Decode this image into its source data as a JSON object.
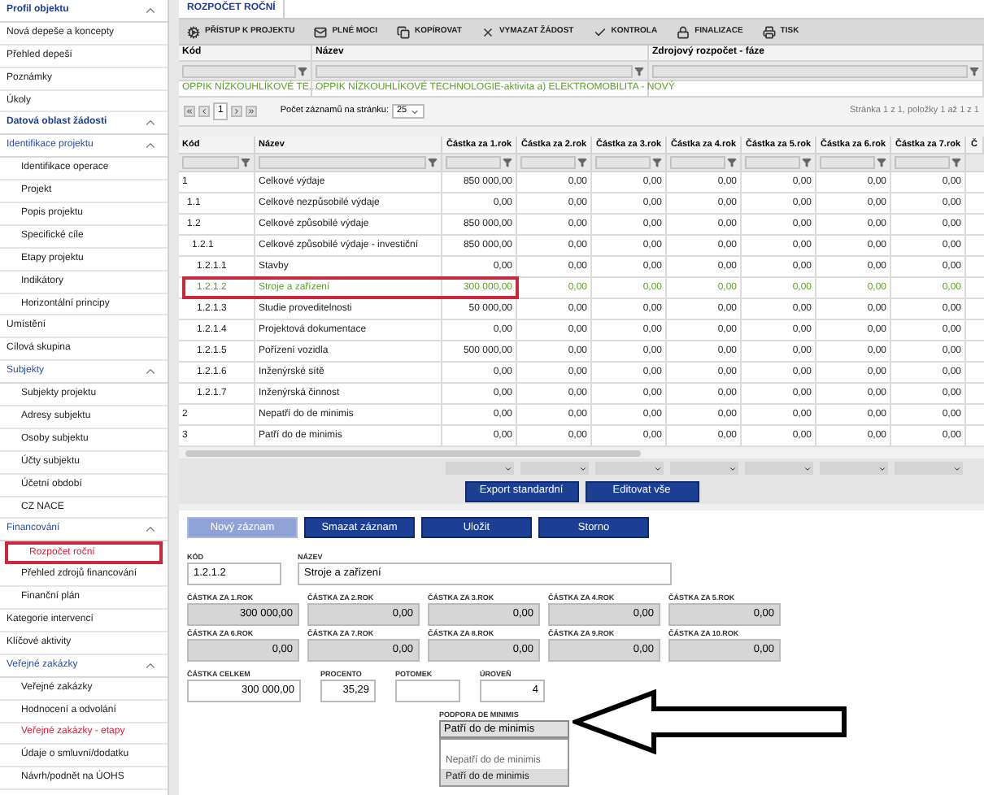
{
  "sidebar": {
    "groups": [
      {
        "title": "Profil objektu",
        "expanded": true,
        "items": [
          {
            "label": "Nová depeše a koncepty",
            "selected": false,
            "flagged": false
          },
          {
            "label": "Přehled depeší",
            "selected": false,
            "flagged": false
          },
          {
            "label": "Poznámky",
            "selected": false,
            "flagged": false
          },
          {
            "label": "Úkoly",
            "selected": false,
            "flagged": false
          }
        ]
      },
      {
        "title": "Datová oblast žádosti",
        "expanded": true,
        "items": [
          {
            "label": "Identifikace projektu",
            "expanded": true,
            "children": [
              {
                "label": "Identifikace operace",
                "selected": false,
                "flagged": false
              },
              {
                "label": "Projekt",
                "selected": false,
                "flagged": false
              },
              {
                "label": "Popis projektu",
                "selected": false,
                "flagged": false
              },
              {
                "label": "Specifické cíle",
                "selected": false,
                "flagged": false
              },
              {
                "label": "Etapy projektu",
                "selected": false,
                "flagged": false
              },
              {
                "label": "Indikátory",
                "selected": false,
                "flagged": false
              },
              {
                "label": "Horizontální principy",
                "selected": false,
                "flagged": false
              }
            ]
          },
          {
            "label": "Umístění",
            "selected": false,
            "flagged": false
          },
          {
            "label": "Cílová skupina",
            "selected": false,
            "flagged": false
          },
          {
            "label": "Subjekty",
            "expanded": true,
            "children": [
              {
                "label": "Subjekty projektu",
                "selected": false,
                "flagged": false
              },
              {
                "label": "Adresy subjektu",
                "selected": false,
                "flagged": false
              },
              {
                "label": "Osoby subjektu",
                "selected": false,
                "flagged": false
              },
              {
                "label": "Účty subjektu",
                "selected": false,
                "flagged": false
              },
              {
                "label": "Účetní období",
                "selected": false,
                "flagged": false
              },
              {
                "label": "CZ NACE",
                "selected": false,
                "flagged": false
              }
            ]
          },
          {
            "label": "Financování",
            "expanded": true,
            "children": [
              {
                "label": "Rozpočet roční",
                "selected": true,
                "flagged": true
              },
              {
                "label": "Přehled zdrojů financování",
                "selected": false,
                "flagged": false
              },
              {
                "label": "Finanční plán",
                "selected": false,
                "flagged": false
              }
            ]
          },
          {
            "label": "Kategorie intervencí",
            "selected": false,
            "flagged": false
          },
          {
            "label": "Klíčové aktivity",
            "selected": false,
            "flagged": false
          },
          {
            "label": "Veřejné zakázky",
            "expanded": true,
            "children": [
              {
                "label": "Veřejné zakázky",
                "selected": false,
                "flagged": false
              },
              {
                "label": "Hodnocení a odvolání",
                "selected": false,
                "flagged": false
              },
              {
                "label": "Veřejné zakázky - etapy",
                "selected": false,
                "flagged": true
              },
              {
                "label": "Údaje o smluvní/dodatku",
                "selected": false,
                "flagged": false
              },
              {
                "label": "Návrh/podnět na ÚOHS",
                "selected": false,
                "flagged": false
              }
            ]
          }
        ]
      }
    ]
  },
  "tabs": [
    {
      "label": "ROZPOČET ROČNÍ",
      "selected": true
    }
  ],
  "toolbar": [
    "PŘÍSTUP K PROJEKTU",
    "PLNÉ MOCI",
    "KOPÍROVAT",
    "VYMAZAT ŽÁDOST",
    "KONTROLA",
    "FINALIZACE",
    "TISK"
  ],
  "source_grid": {
    "columns": [
      "Kód",
      "Název",
      "Zdrojový rozpočet - fáze"
    ],
    "rows": [
      {
        "cells": [
          "OPPIK NÍZKOUHLÍKOVÉ TE...",
          "OPPIK NÍZKOUHLÍKOVÉ TECHNOLOGIE-aktivita a) ELEKTROMOBILITA - NOVÝ"
        ],
        "selected": true
      }
    ]
  },
  "pager": {
    "page": "1",
    "per_page_label": "Počet záznamů na stránku:",
    "per_page": "25",
    "info": "Stránka 1 z 1, položky 1 až 1 z 1"
  },
  "budget_table": {
    "columns": [
      "Kód",
      "Název",
      "Částka za 1.rok",
      "Částka za 2.rok",
      "Částka za 3.rok",
      "Částka za 4.rok",
      "Částka za 5.rok",
      "Částka za 6.rok",
      "Částka za 7.rok",
      "Č"
    ],
    "rows": [
      {
        "code": "1",
        "name": "Celkové výdaje",
        "values": [
          "850 000,00",
          "0,00",
          "0,00",
          "0,00",
          "0,00",
          "0,00",
          "0,00"
        ],
        "selected": false,
        "children": [
          {
            "code": "1.1",
            "name": "Celkové nezpůsobilé výdaje",
            "values": [
              "0,00",
              "0,00",
              "0,00",
              "0,00",
              "0,00",
              "0,00",
              "0,00"
            ],
            "selected": false
          },
          {
            "code": "1.2",
            "name": "Celkové způsobilé výdaje",
            "values": [
              "850 000,00",
              "0,00",
              "0,00",
              "0,00",
              "0,00",
              "0,00",
              "0,00"
            ],
            "selected": false,
            "children": [
              {
                "code": "1.2.1",
                "name": "Celkové způsobilé výdaje - investiční",
                "values": [
                  "850 000,00",
                  "0,00",
                  "0,00",
                  "0,00",
                  "0,00",
                  "0,00",
                  "0,00"
                ],
                "selected": false,
                "children": [
                  {
                    "code": "1.2.1.1",
                    "name": "Stavby",
                    "values": [
                      "0,00",
                      "0,00",
                      "0,00",
                      "0,00",
                      "0,00",
                      "0,00",
                      "0,00"
                    ],
                    "selected": false
                  },
                  {
                    "code": "1.2.1.2",
                    "name": "Stroje a zařízení",
                    "values": [
                      "300 000,00",
                      "0,00",
                      "0,00",
                      "0,00",
                      "0,00",
                      "0,00",
                      "0,00"
                    ],
                    "selected": true
                  },
                  {
                    "code": "1.2.1.3",
                    "name": "Studie proveditelnosti",
                    "values": [
                      "50 000,00",
                      "0,00",
                      "0,00",
                      "0,00",
                      "0,00",
                      "0,00",
                      "0,00"
                    ],
                    "selected": false
                  },
                  {
                    "code": "1.2.1.4",
                    "name": "Projektová dokumentace",
                    "values": [
                      "0,00",
                      "0,00",
                      "0,00",
                      "0,00",
                      "0,00",
                      "0,00",
                      "0,00"
                    ],
                    "selected": false
                  },
                  {
                    "code": "1.2.1.5",
                    "name": "Pořízení vozidla",
                    "values": [
                      "500 000,00",
                      "0,00",
                      "0,00",
                      "0,00",
                      "0,00",
                      "0,00",
                      "0,00"
                    ],
                    "selected": false
                  },
                  {
                    "code": "1.2.1.6",
                    "name": "Inženýrské sítě",
                    "values": [
                      "0,00",
                      "0,00",
                      "0,00",
                      "0,00",
                      "0,00",
                      "0,00",
                      "0,00"
                    ],
                    "selected": false
                  },
                  {
                    "code": "1.2.1.7",
                    "name": "Inženýrská činnost",
                    "values": [
                      "0,00",
                      "0,00",
                      "0,00",
                      "0,00",
                      "0,00",
                      "0,00",
                      "0,00"
                    ],
                    "selected": false
                  }
                ]
              }
            ]
          }
        ]
      },
      {
        "code": "2",
        "name": "Nepatří do de minimis",
        "values": [
          "0,00",
          "0,00",
          "0,00",
          "0,00",
          "0,00",
          "0,00",
          "0,00"
        ],
        "selected": false
      },
      {
        "code": "3",
        "name": "Patří do de minimis",
        "values": [
          "0,00",
          "0,00",
          "0,00",
          "0,00",
          "0,00",
          "0,00",
          "0,00"
        ],
        "selected": false
      }
    ]
  },
  "table_actions": [
    "Export standardní",
    "Editovat vše"
  ],
  "form": {
    "buttons": [
      {
        "label": "Nový záznam",
        "disabled": true
      },
      {
        "label": "Smazat záznam",
        "disabled": false
      },
      {
        "label": "Uložit",
        "disabled": false
      },
      {
        "label": "Storno",
        "disabled": false
      }
    ],
    "code": {
      "label": "KÓD",
      "value": "1.2.1.2"
    },
    "name": {
      "label": "NÁZEV",
      "value": "Stroje a zařízení"
    },
    "amounts": [
      {
        "label": "ČÁSTKA ZA 1.ROK",
        "value": "300 000,00"
      },
      {
        "label": "ČÁSTKA ZA 2.ROK",
        "value": "0,00"
      },
      {
        "label": "ČÁSTKA ZA 3.ROK",
        "value": "0,00"
      },
      {
        "label": "ČÁSTKA ZA 4.ROK",
        "value": "0,00"
      },
      {
        "label": "ČÁSTKA ZA 5.ROK",
        "value": "0,00"
      },
      {
        "label": "ČÁSTKA ZA 6.ROK",
        "value": "0,00"
      },
      {
        "label": "ČÁSTKA ZA 7.ROK",
        "value": "0,00"
      },
      {
        "label": "ČÁSTKA ZA 8.ROK",
        "value": "0,00"
      },
      {
        "label": "ČÁSTKA ZA 9.ROK",
        "value": "0,00"
      },
      {
        "label": "ČÁSTKA ZA 10.ROK",
        "value": "0,00"
      }
    ],
    "totals": [
      {
        "label": "ČÁSTKA CELKEM",
        "value": "300 000,00"
      },
      {
        "label": "PROCENTO",
        "value": "35,29"
      },
      {
        "label": "POTOMEK"
      },
      {
        "label": "ÚROVEŇ",
        "value": "4"
      }
    ],
    "de_minimis": {
      "label": "PODPORA DE MINIMIS",
      "value": "Patří do de minimis",
      "expanded": true,
      "options": [
        {
          "label": "Nepatří do de minimis",
          "selected": false
        },
        {
          "label": "Patří do de minimis",
          "selected": true
        }
      ]
    }
  }
}
